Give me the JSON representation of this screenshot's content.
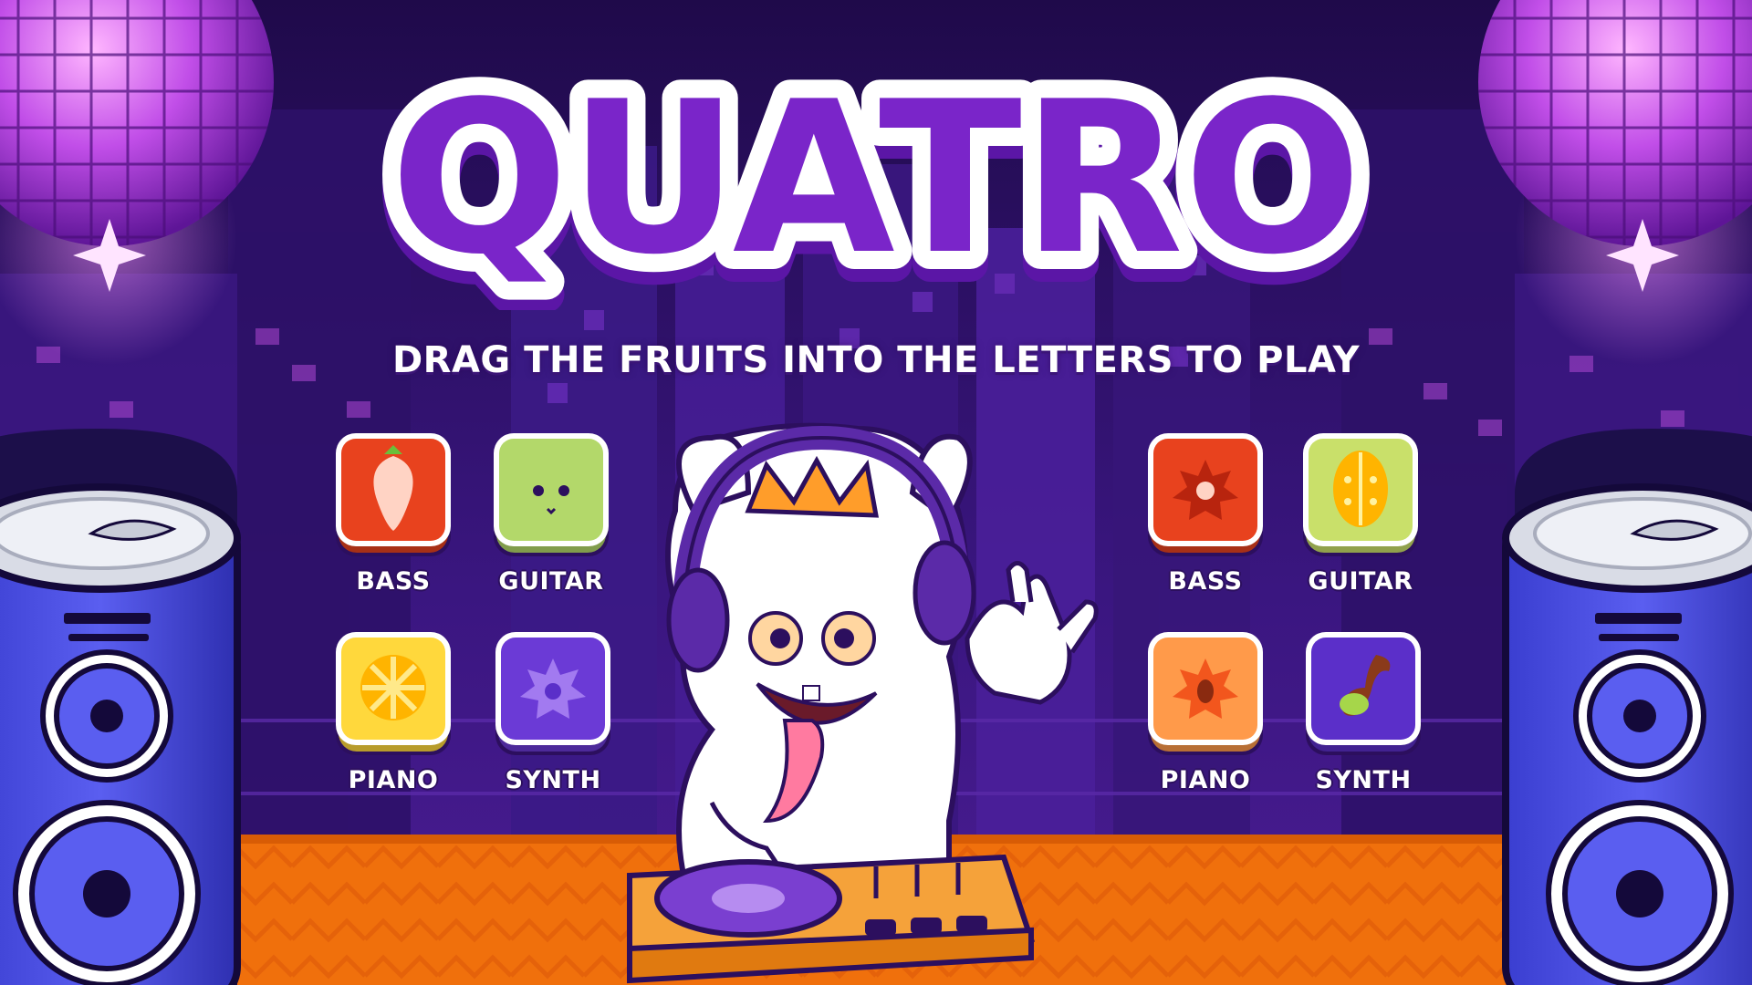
{
  "title": "QUATRO",
  "subtitle": "DRAG THE FRUITS INTO THE LETTERS TO PLAY",
  "colors": {
    "background": "#2a0f5c",
    "title_fill": "#7a25c9",
    "stage_floor": "#f0700c",
    "speaker": "#4a4ee0"
  },
  "instruments": [
    {
      "label": "BASS",
      "icon": "strawberry-slice-icon",
      "color": "#e8421e"
    },
    {
      "label": "GUITAR",
      "icon": "green-apple-face-icon",
      "color": "#b3d86a"
    },
    {
      "label": "PIANO",
      "icon": "orange-slice-icon",
      "color": "#ffd83c"
    },
    {
      "label": "SYNTH",
      "icon": "purple-flower-icon",
      "color": "#6b3ad6"
    },
    {
      "label": "BASS",
      "icon": "red-fruit-slice-icon",
      "color": "#e8421e"
    },
    {
      "label": "GUITAR",
      "icon": "melon-slice-icon",
      "color": "#c9e06a"
    },
    {
      "label": "PIANO",
      "icon": "orange-fruit-slice-icon",
      "color": "#ff9a4a"
    },
    {
      "label": "SYNTH",
      "icon": "purple-leaf-fruit-icon",
      "color": "#5b2fc9"
    }
  ]
}
